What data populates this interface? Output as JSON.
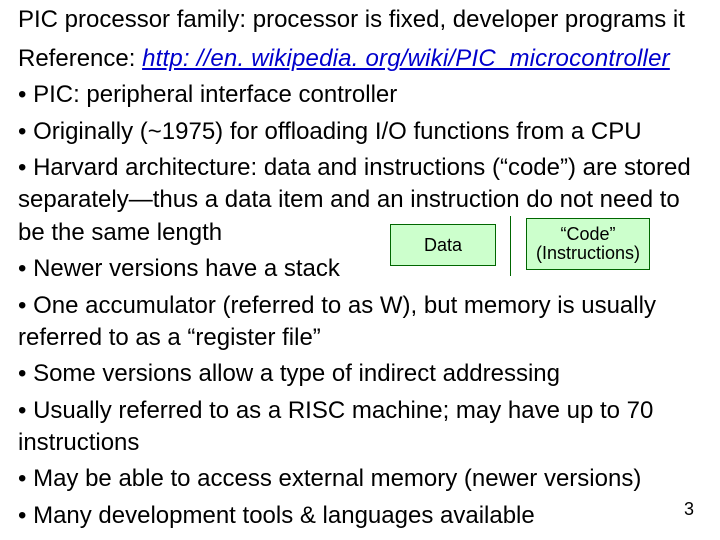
{
  "title": "PIC processor family: processor is fixed, developer programs it",
  "reference": {
    "label": "Reference:  ",
    "url_text": "http: //en. wikipedia. org/wiki/PIC_microcontroller"
  },
  "bullets": [
    "• PIC:  peripheral interface controller",
    "• Originally (~1975) for offloading I/O functions from a CPU",
    "• Harvard architecture:  data and instructions (“code”) are stored separately—thus a data item and an instruction do not need to be the same length",
    "• Newer versions have a stack",
    "• One accumulator (referred to as W), but memory is usually referred to as a “register file”",
    "• Some versions allow a type of indirect addressing",
    "• Usually referred to as a RISC machine; may have up to 70 instructions",
    "• May be able to access external memory (newer versions)",
    "• Many development tools & languages available"
  ],
  "diagram": {
    "data_label": "Data",
    "code_label_1": "“Code”",
    "code_label_2": "(Instructions)"
  },
  "page_number": "3"
}
